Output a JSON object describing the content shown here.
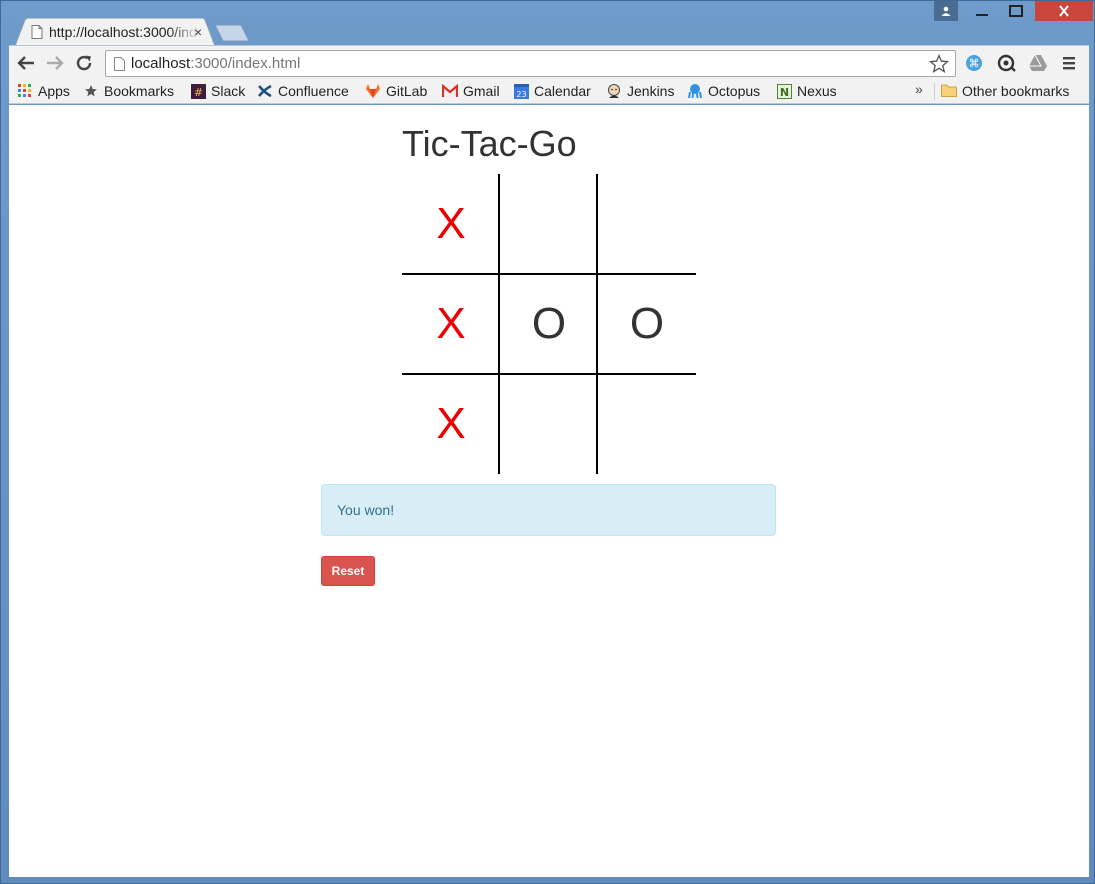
{
  "browser": {
    "tab_title": "http://localhost:3000/index.html",
    "tab_close": "×",
    "url_host": "localhost",
    "url_path": ":3000/index.html"
  },
  "bookmarks": {
    "items": [
      {
        "label": "Apps",
        "icon": "apps-grid-icon"
      },
      {
        "label": "Bookmarks",
        "icon": "star-icon"
      },
      {
        "label": "Slack",
        "icon": "slack-icon"
      },
      {
        "label": "Confluence",
        "icon": "confluence-icon"
      },
      {
        "label": "GitLab",
        "icon": "gitlab-icon"
      },
      {
        "label": "Gmail",
        "icon": "gmail-icon"
      },
      {
        "label": "Calendar",
        "icon": "calendar-icon"
      },
      {
        "label": "Jenkins",
        "icon": "jenkins-icon"
      },
      {
        "label": "Octopus",
        "icon": "octopus-icon"
      },
      {
        "label": "Nexus",
        "icon": "nexus-icon"
      }
    ],
    "overflow": "»",
    "other": "Other bookmarks",
    "calendar_day": "23"
  },
  "game": {
    "title": "Tic-Tac-Go",
    "board": [
      "X",
      "",
      "",
      "X",
      "O",
      "O",
      "X",
      "",
      ""
    ],
    "status": "You won!",
    "reset_label": "Reset"
  },
  "colors": {
    "x_mark": "#ee0000",
    "o_mark": "#333333",
    "alert_bg": "#d9edf7",
    "reset_bg": "#d9534f"
  }
}
